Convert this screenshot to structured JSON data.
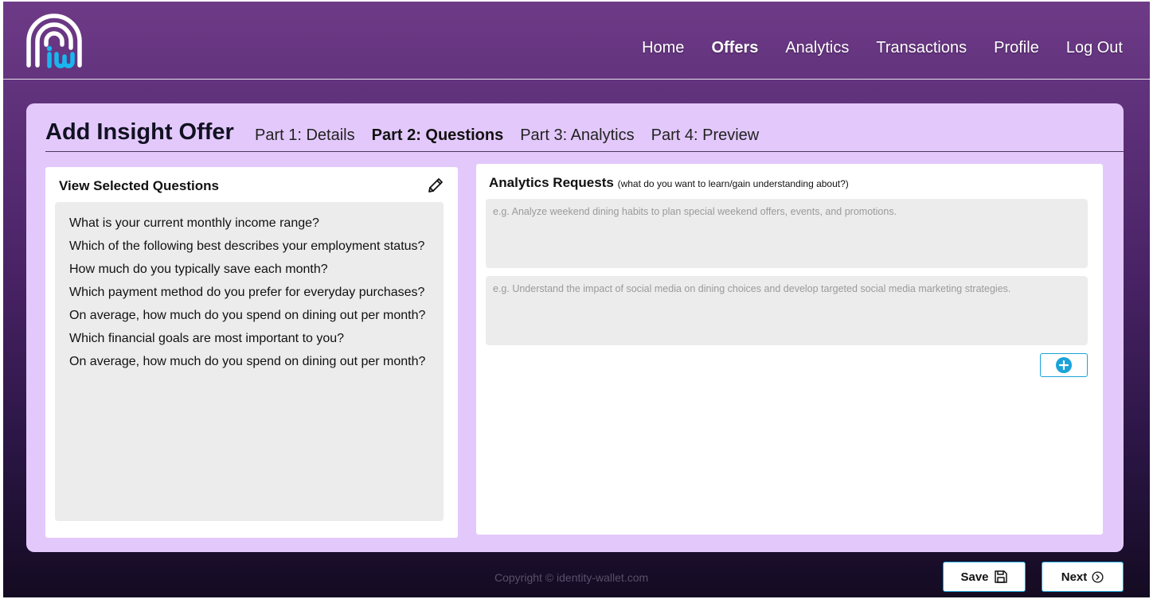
{
  "header": {
    "nav": [
      {
        "label": "Home"
      },
      {
        "label": "Offers"
      },
      {
        "label": "Analytics"
      },
      {
        "label": "Transactions"
      },
      {
        "label": "Profile"
      },
      {
        "label": "Log Out"
      }
    ],
    "active_nav": "Offers"
  },
  "card": {
    "title": "Add Insight Offer",
    "steps": [
      {
        "label": "Part 1: Details"
      },
      {
        "label": "Part 2: Questions"
      },
      {
        "label": "Part 3: Analytics"
      },
      {
        "label": "Part 4: Preview"
      }
    ],
    "active_step": "Part 2: Questions"
  },
  "selected_questions": {
    "title": "View Selected Questions",
    "items": [
      "What is your current monthly income range?",
      "Which of the following best describes your employment status?",
      "How much do you typically save each month?",
      "Which payment method do you prefer for everyday purchases?",
      "On average, how much do you spend on dining out per month?",
      "Which financial goals are most important to you?",
      "On average, how much do you spend on dining out per month?"
    ]
  },
  "analytics_requests": {
    "title": "Analytics Requests",
    "subtitle": "(what do you want to learn/gain understanding about?)",
    "inputs": [
      {
        "value": "",
        "placeholder": "e.g. Analyze weekend dining habits to plan special weekend offers, events, and promotions."
      },
      {
        "value": "",
        "placeholder": "e.g. Understand the impact of social media on dining choices and develop targeted social media marketing strategies."
      }
    ]
  },
  "footer": {
    "copyright": "Copyright © identity-wallet.com",
    "save_label": "Save",
    "next_label": "Next"
  },
  "colors": {
    "accent": "#1aa3d9",
    "card_bg": "#e3c9fb",
    "header_top": "#6e3a87",
    "footer_bottom": "#140b22"
  }
}
